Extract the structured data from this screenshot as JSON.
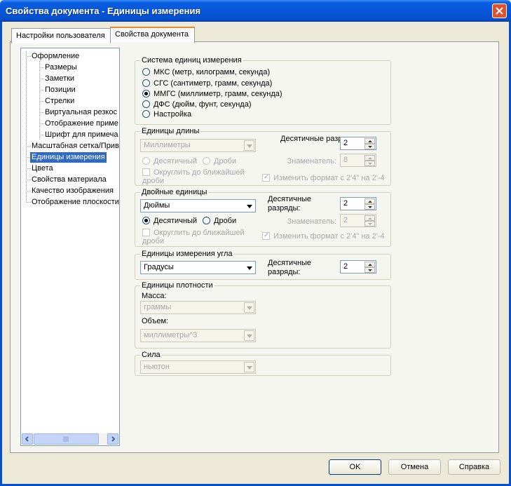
{
  "window": {
    "title": "Свойства документа - Единицы измерения"
  },
  "tabs": [
    {
      "label": "Настройки пользователя"
    },
    {
      "label": "Свойства документа"
    }
  ],
  "tree": {
    "items": [
      "Оформление",
      "Размеры",
      "Заметки",
      "Позиции",
      "Стрелки",
      "Виртуальная резкос",
      "Отображение приме",
      "Шрифт для примеча",
      "Масштабная сетка/Прив",
      "Единицы измерения",
      "Цвета",
      "Свойства материала",
      "Качество изображения",
      "Отображение плоскости"
    ],
    "selected": "Единицы измерения"
  },
  "unit_system": {
    "title": "Система единиц измерения",
    "options": [
      "МКС (метр, килограмм, секунда)",
      "СГС (сантиметр, грамм, секунда)",
      "ММГС (миллиметр, грамм, секунда)",
      "ДФС (дюйм, фунт, секунда)",
      "Настройка"
    ],
    "selected": "ММГС (миллиметр, грамм, секунда)"
  },
  "length_units": {
    "title": "Единицы длины",
    "unit_value": "Миллиметры",
    "decimal_label": "Десятичные разряды:",
    "decimal_value": "2",
    "radio_decimal": "Десятичный",
    "radio_fractions": "Дроби",
    "denominator_label": "Знаменатель:",
    "denominator_value": "8",
    "round_label": "Округлить до ближайшей дроби",
    "format_label": "Изменить формат с 2'4\" на 2'-4"
  },
  "dual_units": {
    "title": "Двойные единицы",
    "unit_value": "Дюймы",
    "decimal_label": "Десятичные разряды:",
    "decimal_value": "2",
    "radio_decimal": "Десятичный",
    "radio_fractions": "Дроби",
    "denominator_label": "Знаменатель:",
    "denominator_value": "2",
    "round_label": "Округлить до ближайшей дроби",
    "format_label": "Изменить формат с 2'4\" на 2'-4"
  },
  "angle_units": {
    "title": "Единицы измерения угла",
    "unit_value": "Градусы",
    "decimal_label": "Десятичные разряды:",
    "decimal_value": "2"
  },
  "density_units": {
    "title": "Единицы плотности",
    "mass_label": "Масса:",
    "mass_value": "граммы",
    "volume_label": "Объем:",
    "volume_value": "миллиметры^3"
  },
  "force": {
    "title": "Сила",
    "value": "ньютон"
  },
  "footer": {
    "ok": "OK",
    "cancel": "Отмена",
    "help": "Справка"
  }
}
